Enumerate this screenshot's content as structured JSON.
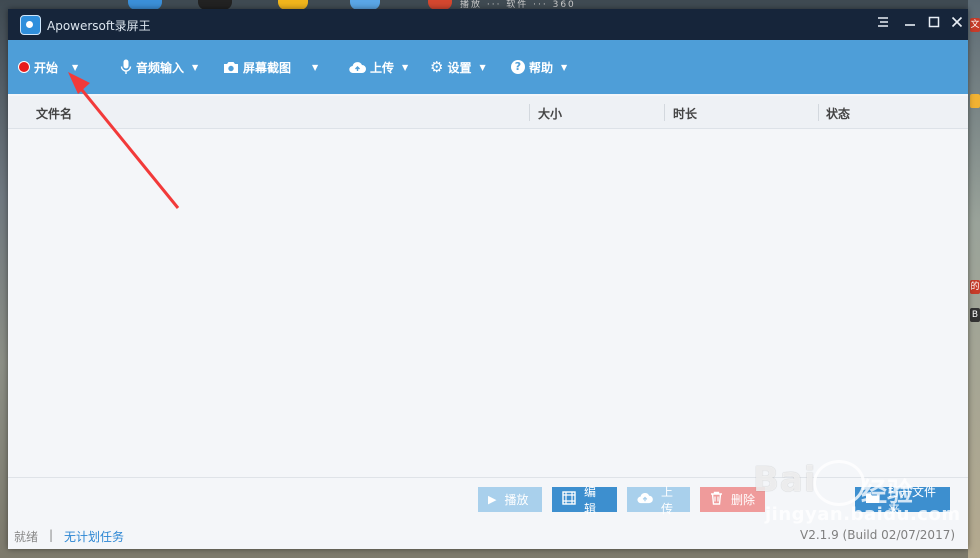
{
  "window": {
    "title": "Apowersoft录屏王"
  },
  "toolbar": {
    "start_label": "开始",
    "audio_label": "音频输入",
    "screenshot_label": "屏幕截图",
    "upload_label": "上传",
    "settings_label": "设置",
    "help_label": "帮助",
    "help_glyph": "?",
    "caret": "▼"
  },
  "table": {
    "columns": [
      "文件名",
      "大小",
      "时长",
      "状态"
    ],
    "rows": []
  },
  "actions": {
    "play": "播放",
    "edit": "编辑",
    "upload": "上传",
    "delete": "删除",
    "open_folder": "打开文件夹"
  },
  "status": {
    "state": "就绪",
    "separator": "|",
    "schedule": "无计划任务",
    "version": "V2.1.9 (Build 02/07/2017)"
  },
  "watermark": {
    "logo": "Bai",
    "logo_cn": "经验",
    "url": "jingyan.baidu.com"
  },
  "desktop": {
    "taskbar_text": "播放 ··· 软件 ··· 360",
    "side_badges": [
      "文",
      "",
      "的",
      "B"
    ]
  },
  "icons": {
    "window_menu": "menu-icon",
    "minimize": "minimize-icon",
    "maximize": "maximize-icon",
    "close": "close-icon",
    "record": "record-dot-icon",
    "microphone": "microphone-icon",
    "camera": "camera-icon",
    "cloud_upload": "cloud-upload-icon",
    "gear": "gear-icon",
    "help": "help-circle-icon",
    "play": "play-icon",
    "edit": "film-edit-icon",
    "trash": "trash-icon",
    "folder": "folder-icon"
  },
  "colors": {
    "titlebar": "#16253a",
    "toolbar": "#4e9ed8",
    "record_red": "#e81c1c",
    "annotation_arrow": "#f23a3a",
    "link_blue": "#2b86d3"
  }
}
